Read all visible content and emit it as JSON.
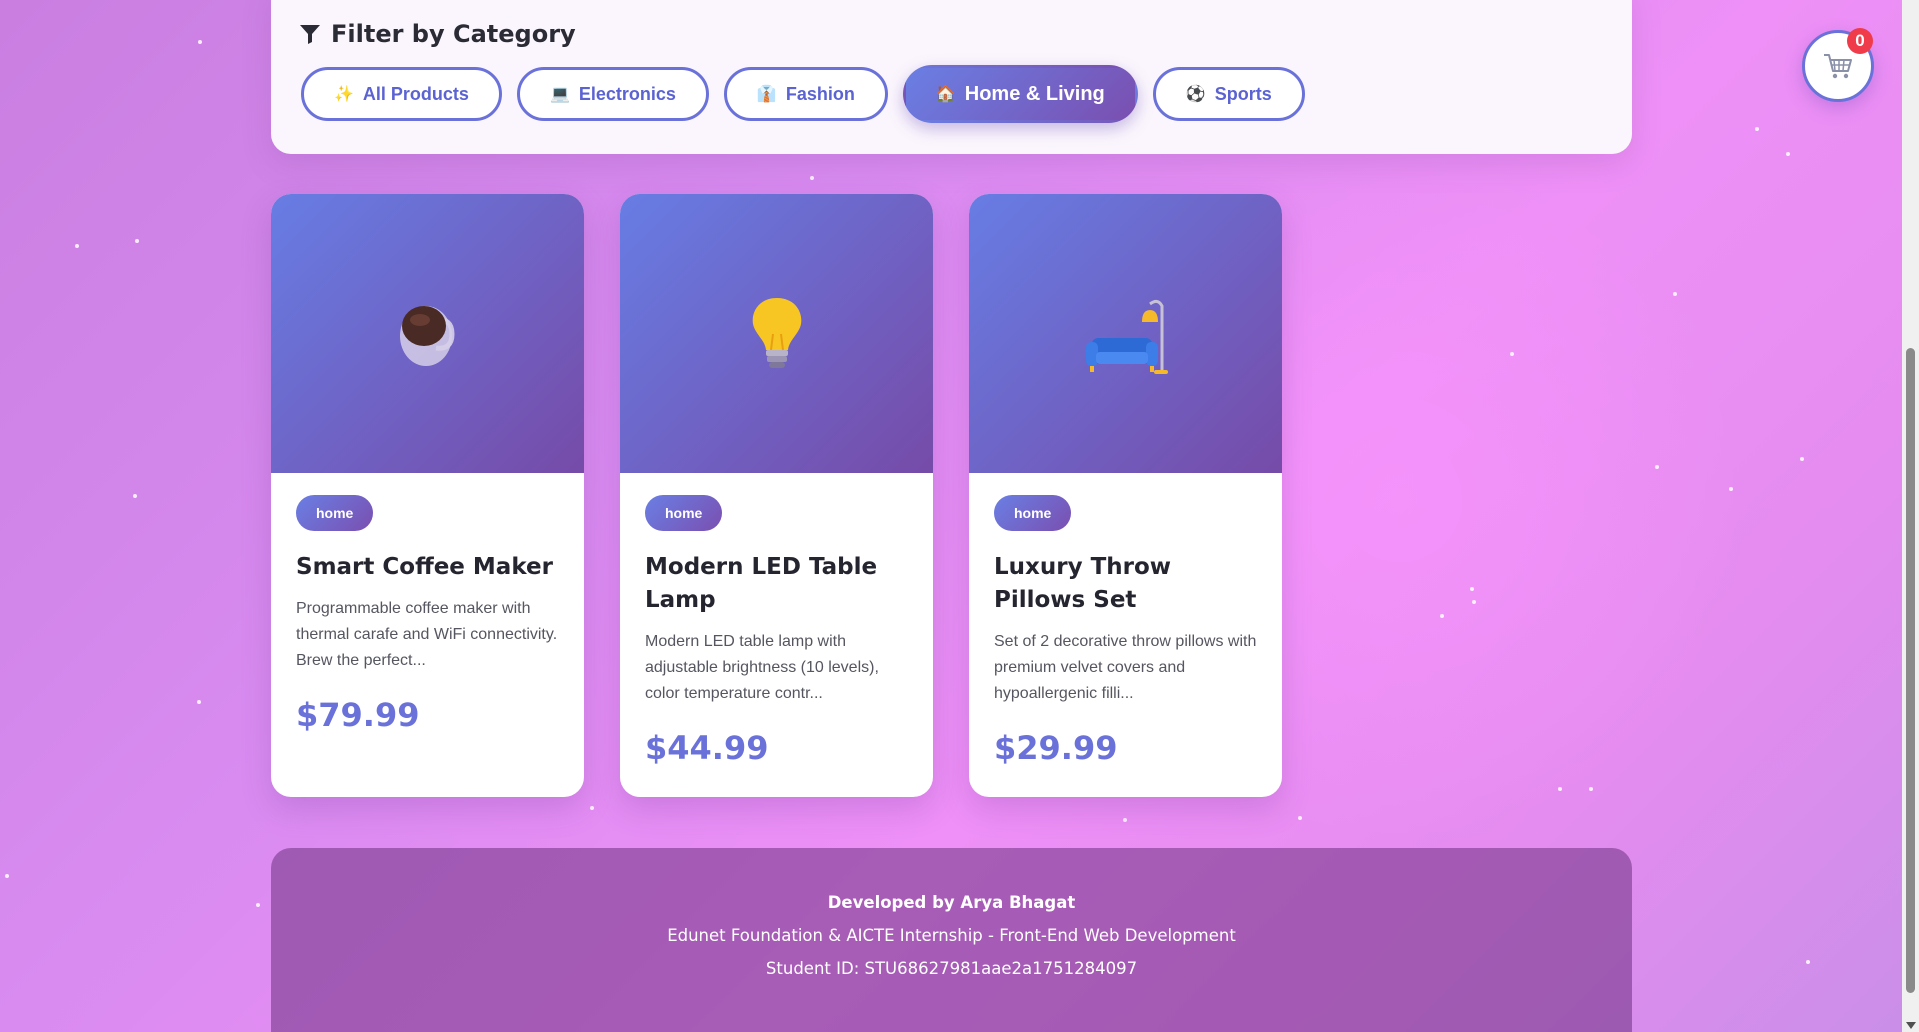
{
  "filter": {
    "title": "Filter by Category",
    "buttons": [
      {
        "emoji": "✨",
        "label": "All Products"
      },
      {
        "emoji": "💻",
        "label": "Electronics"
      },
      {
        "emoji": "👔",
        "label": "Fashion"
      },
      {
        "emoji": "🏠",
        "label": "Home & Living",
        "active": true
      },
      {
        "emoji": "⚽",
        "label": "Sports"
      }
    ]
  },
  "cart": {
    "count": "0",
    "icon": "cart-icon"
  },
  "products": [
    {
      "emoji": "☕",
      "tag": "home",
      "title": "Smart Coffee Maker",
      "description": "Programmable coffee maker with thermal carafe and WiFi connectivity. Brew the perfect...",
      "price": "$79.99"
    },
    {
      "emoji": "💡",
      "tag": "home",
      "title": "Modern LED Table Lamp",
      "description": "Modern LED table lamp with adjustable brightness (10 levels), color temperature contr...",
      "price": "$44.99"
    },
    {
      "emoji": "🛋️",
      "tag": "home",
      "title": "Luxury Throw Pillows Set",
      "description": "Set of 2 decorative throw pillows with premium velvet covers and hypoallergenic filli...",
      "price": "$29.99"
    }
  ],
  "footer": {
    "developer": "Developed by Arya Bhagat",
    "program": "Edunet Foundation & AICTE Internship - Front-End Web Development",
    "student_id": "Student ID: STU68627981aae2a1751284097"
  },
  "colors": {
    "accent": "#6a72d9",
    "gradient_start": "#677de4",
    "gradient_end": "#764ba8",
    "badge": "#ef3b4a"
  }
}
